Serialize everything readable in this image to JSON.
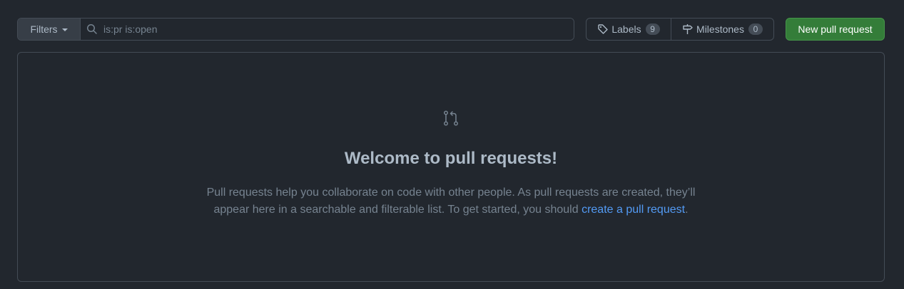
{
  "toolbar": {
    "filters_label": "Filters",
    "search_value": "is:pr is:open",
    "labels_label": "Labels",
    "labels_count": "9",
    "milestones_label": "Milestones",
    "milestones_count": "0",
    "new_pr_label": "New pull request"
  },
  "blankslate": {
    "icon": "git-pull-request-icon",
    "title": "Welcome to pull requests!",
    "text_before": "Pull requests help you collaborate on code with other people. As pull requests are created, they’ll appear here in a searchable and filterable list. To get started, you should ",
    "link_text": "create a pull request",
    "text_after": "."
  },
  "colors": {
    "background": "#22272e",
    "border": "#444c56",
    "primary_button": "#347d39",
    "link": "#539bf5"
  }
}
